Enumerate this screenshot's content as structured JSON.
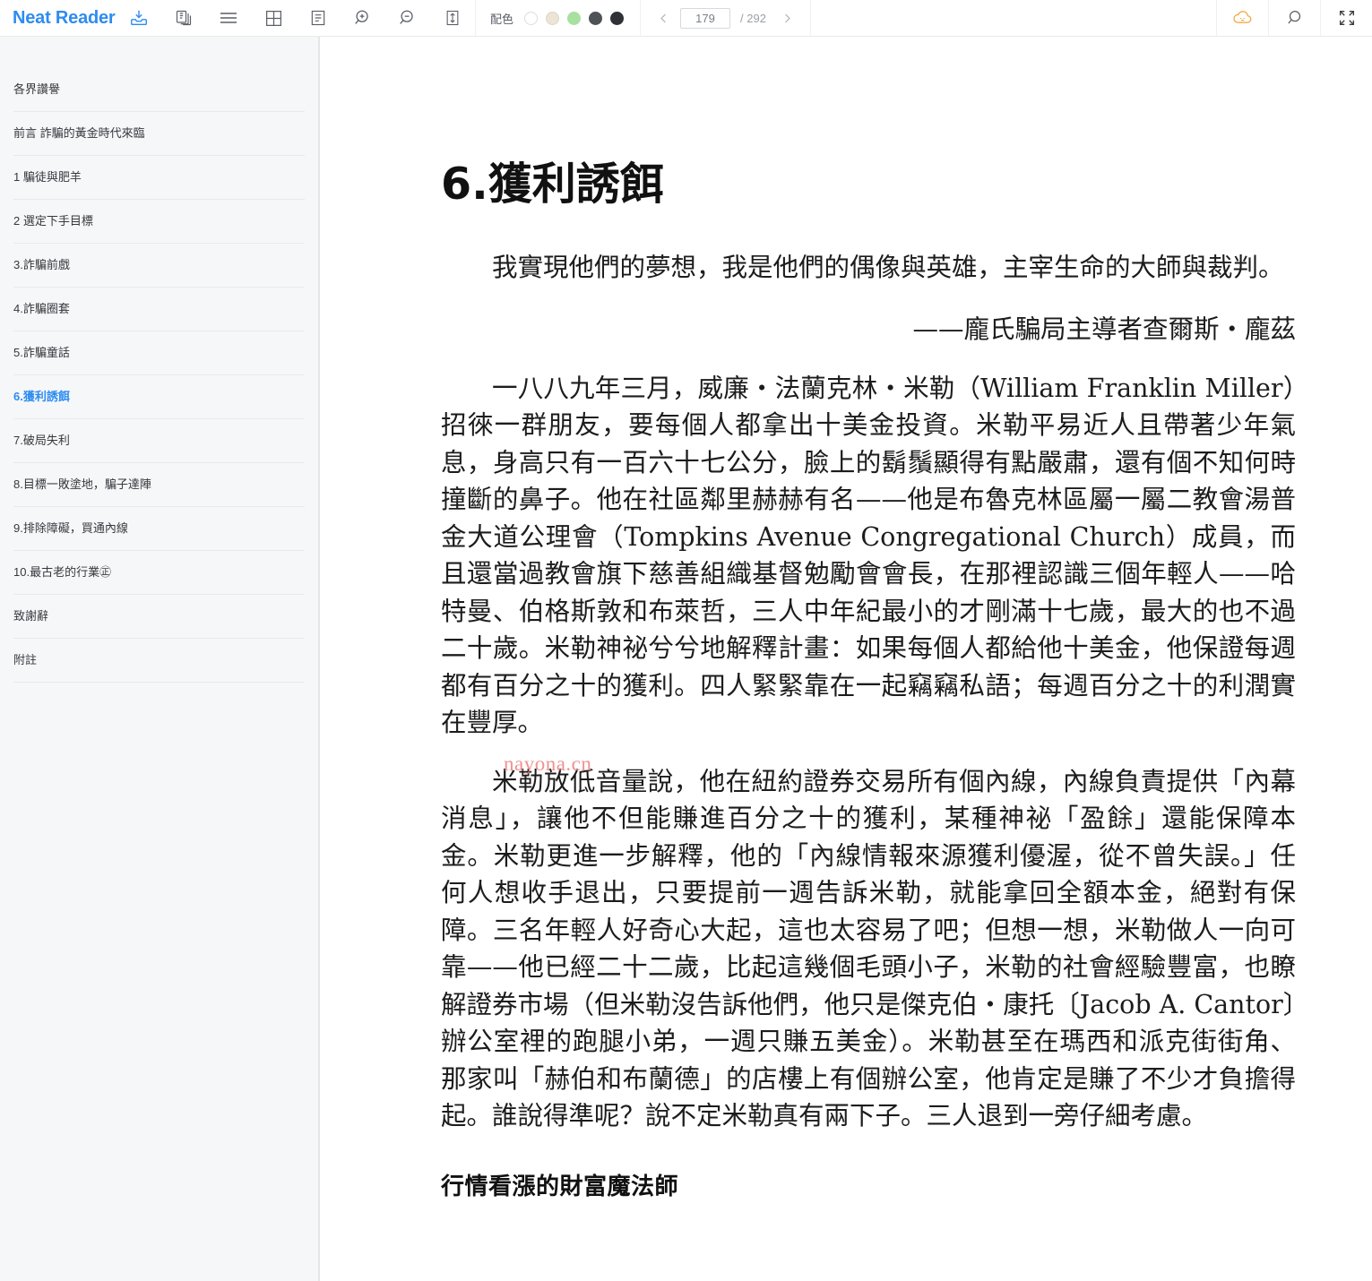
{
  "app": {
    "brand": "Neat Reader"
  },
  "toolbar": {
    "icons": [
      {
        "name": "save-to-library-icon",
        "glyph": "save-tray"
      },
      {
        "name": "copy-icon",
        "glyph": "copy"
      },
      {
        "name": "toc-list-icon",
        "glyph": "hamburger"
      },
      {
        "name": "grid-layout-icon",
        "glyph": "grid"
      },
      {
        "name": "note-icon",
        "glyph": "note"
      },
      {
        "name": "zoom-in-icon",
        "glyph": "zoom-in"
      },
      {
        "name": "zoom-out-icon",
        "glyph": "zoom-out"
      },
      {
        "name": "line-height-icon",
        "glyph": "line-height"
      }
    ],
    "color_scheme": {
      "label": "配色",
      "swatches": [
        {
          "name": "scheme-white",
          "color": "#ffffff",
          "border": "#d9dde2"
        },
        {
          "name": "scheme-sepia",
          "color": "#ece4d4",
          "border": "#ddd5c4"
        },
        {
          "name": "scheme-green",
          "color": "#a8e0a0",
          "border": "#a8e0a0"
        },
        {
          "name": "scheme-dark-gray",
          "color": "#4e5257",
          "border": "#4e5257"
        },
        {
          "name": "scheme-black",
          "color": "#2e3236",
          "border": "#2e3236"
        }
      ]
    },
    "pager": {
      "prev_label": "‹",
      "next_label": "›",
      "current_page": "179",
      "total_label": "/ 292",
      "placeholder": "179"
    },
    "right_icons": [
      {
        "name": "cloud-sync-icon",
        "glyph": "cloud",
        "color": "#f0a236"
      },
      {
        "name": "search-icon",
        "glyph": "search",
        "color": "#5a5f66"
      },
      {
        "name": "fullscreen-icon",
        "glyph": "fullscreen",
        "color": "#5a5f66"
      }
    ]
  },
  "sidebar": {
    "items": [
      {
        "label": "各界讚譽",
        "active": false
      },
      {
        "label": "前言 詐騙的黃金時代來臨",
        "active": false
      },
      {
        "label": "1 騙徒與肥羊",
        "active": false
      },
      {
        "label": "2 選定下手目標",
        "active": false
      },
      {
        "label": "3.詐騙前戲",
        "active": false
      },
      {
        "label": "4.詐騙圈套",
        "active": false
      },
      {
        "label": "5.詐騙童話",
        "active": false
      },
      {
        "label": "6.獲利誘餌",
        "active": true
      },
      {
        "label": "7.破局失利",
        "active": false
      },
      {
        "label": "8.目標一敗塗地，騙子達陣",
        "active": false
      },
      {
        "label": "9.排除障礙，買通內線",
        "active": false
      },
      {
        "label": "10.最古老的行業㊣",
        "active": false
      },
      {
        "label": "致謝辭",
        "active": false
      },
      {
        "label": "附註",
        "active": false
      }
    ]
  },
  "content": {
    "chapter_title": "6.獲利誘餌",
    "epigraph": "我實現他們的夢想，我是他們的偶像與英雄，主宰生命的大師與裁判。",
    "attribution": "——龐氏騙局主導者查爾斯・龐茲",
    "paragraph_1": "一八八九年三月，威廉・法蘭克林・米勒（William Franklin Miller）招徠一群朋友，要每個人都拿出十美金投資。米勒平易近人且帶著少年氣息，身高只有一百六十七公分，臉上的鬍鬚顯得有點嚴肅，還有個不知何時撞斷的鼻子。他在社區鄰里赫赫有名——他是布魯克林區屬一屬二教會湯普金大道公理會（Tompkins Avenue Congregational Church）成員，而且還當過教會旗下慈善組織基督勉勵會會長，在那裡認識三個年輕人——哈特曼、伯格斯敦和布萊哲，三人中年紀最小的才剛滿十七歲，最大的也不過二十歲。米勒神祕兮兮地解釋計畫：如果每個人都給他十美金，他保證每週都有百分之十的獲利。四人緊緊靠在一起竊竊私語；每週百分之十的利潤實在豐厚。",
    "paragraph_2": "米勒放低音量說，他在紐約證券交易所有個內線，內線負責提供「內幕消息」，讓他不但能賺進百分之十的獲利，某種神祕「盈餘」還能保障本金。米勒更進一步解釋，他的「內線情報來源獲利優渥，從不曾失誤。」任何人想收手退出，只要提前一週告訴米勒，就能拿回全額本金，絕對有保障。三名年輕人好奇心大起，這也太容易了吧；但想一想，米勒做人一向可靠——他已經二十二歲，比起這幾個毛頭小子，米勒的社會經驗豐富，也瞭解證券市場（但米勒沒告訴他們，他只是傑克伯・康托〔Jacob A. Cantor〕辦公室裡的跑腿小弟，一週只賺五美金）。米勒甚至在瑪西和派克街街角、那家叫「赫伯和布蘭德」的店樓上有個辦公室，他肯定是賺了不少才負擔得起。誰說得準呢？說不定米勒真有兩下子。三人退到一旁仔細考慮。",
    "subheading": "行情看漲的財富魔法師",
    "watermark": "nayona.cn"
  }
}
